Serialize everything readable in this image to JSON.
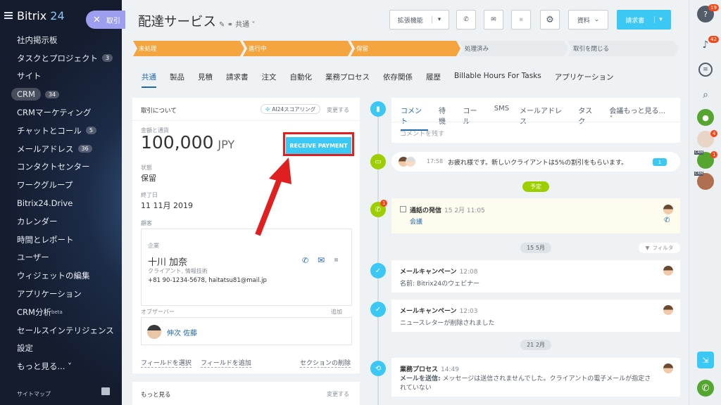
{
  "sidebar": {
    "logo_main": "Bitrix",
    "logo_num": "24",
    "items": [
      {
        "label": "社内掲示板"
      },
      {
        "label": "タスクとプロジェクト",
        "badge": "3"
      },
      {
        "label": "サイト"
      },
      {
        "label": "CRM",
        "badge": "34"
      },
      {
        "label": "CRMマーケティング"
      },
      {
        "label": "チャットとコール",
        "badge": "5"
      },
      {
        "label": "メールアドレス",
        "badge": "36"
      },
      {
        "label": "コンタクトセンター"
      },
      {
        "label": "ワークグループ"
      },
      {
        "label": "Bitrix24.Drive"
      },
      {
        "label": "カレンダー"
      },
      {
        "label": "時間とレポート"
      },
      {
        "label": "ユーザー"
      },
      {
        "label": "ウィジェットの編集"
      },
      {
        "label": "アプリケーション"
      },
      {
        "label": "CRM分析",
        "sup": "beta"
      },
      {
        "label": "セールスインテリジェンス"
      },
      {
        "label": "設定"
      },
      {
        "label": "もっと見る... ˅"
      }
    ],
    "sitemap": "サイトマップ"
  },
  "deal_close": {
    "label": "取引"
  },
  "header": {
    "title": "配達サービス",
    "subtitle": "共通",
    "buttons": {
      "extensions": "拡張機能",
      "documents": "資料",
      "invoice": "請求書"
    }
  },
  "stages": [
    {
      "label": "未処理",
      "active": true
    },
    {
      "label": "進行中",
      "active": true
    },
    {
      "label": "保留",
      "active": true
    },
    {
      "label": "処理済み",
      "active": false
    },
    {
      "label": "取引を閉じる",
      "active": false
    }
  ],
  "tabs": [
    "共通",
    "製品",
    "見積",
    "請求書",
    "注文",
    "自動化",
    "業務プロセス",
    "依存関係",
    "履歴",
    "Billable Hours For Tasks",
    "アプリケーション"
  ],
  "about": {
    "heading": "取引について",
    "ai_scoring": "AI24スコアリング",
    "change": "変更する",
    "amount_label": "金額と通貨",
    "amount": "100,000",
    "currency": "JPY",
    "receive_payment": "RECEIVE PAYMENT",
    "state_label": "状態",
    "state": "保留",
    "end_label": "終了日",
    "end_date": "11 11月 2019",
    "client_label": "顧客",
    "company_label": "企業",
    "contact_name": "十川 加奈",
    "contact_role": "クライアント, 情報技術",
    "contact_info": "+81 90-1234-5678, haitatsu81@mail.jp",
    "observer_label": "オブザーバー",
    "add": "追加",
    "observer_name": "伸次 佐藤",
    "select_field": "フィールドを選択",
    "add_field": "フィールドを追加",
    "delete_section": "セクションの削除",
    "more_heading": "もっと見る",
    "more_change": "変更する"
  },
  "timeline": {
    "tabs": [
      "コメント",
      "待機",
      "コール",
      "SMS",
      "メールアドレス",
      "タスク",
      "会議もっと見る... ˅"
    ],
    "comment_placeholder": "コメントを残す",
    "chat_time": "17:58",
    "chat_text": "お疲れ様です。新しいクライアントは5%の割引をもらいます。",
    "chat_count": "1",
    "planned": "予定",
    "call_title": "通話の発信",
    "call_time": "15 2月 11:05",
    "call_sub": "会議",
    "date1": "15 5月",
    "filter": "フィルタ",
    "email1_title": "メールキャンペーン",
    "email1_time": "12:08",
    "email1_desc": "名前: Bitrix24のウェビナー",
    "email2_title": "メールキャンペーン",
    "email2_time": "12:03",
    "email2_desc": "ニュースレターが削除されました",
    "date2": "21 2月",
    "bp_title": "業務プロセス",
    "bp_time": "14:49",
    "bp_desc_bold": "メールを送信:",
    "bp_desc": " メッセージは送信されませんでした。クライアントの電子メールが指定されていない"
  },
  "rightbar": {
    "badges": [
      "19",
      "42",
      "4",
      "1"
    ],
    "crm": "CRM"
  },
  "colors": {
    "accent": "#3bc8f5",
    "stage_active": "#f5a53f",
    "highlight": "#e02020",
    "link": "#2067b0"
  }
}
